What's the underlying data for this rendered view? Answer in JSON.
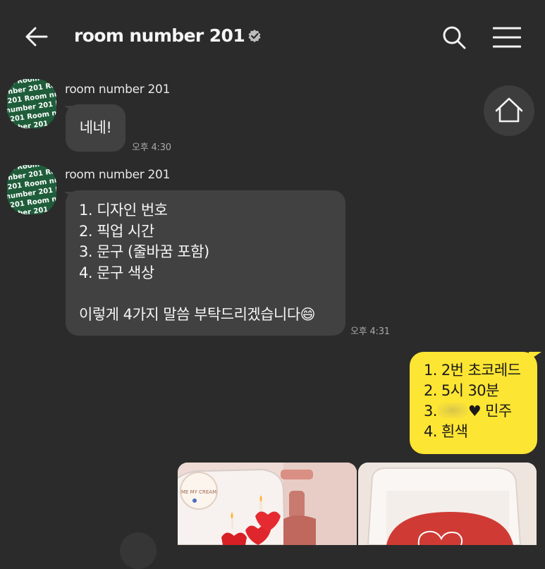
{
  "header": {
    "title": "room number 201",
    "back_icon": "arrow-left-icon",
    "verified_icon": "verified-badge-icon",
    "search_icon": "search-icon",
    "menu_icon": "hamburger-menu-icon"
  },
  "avatar_text": [
    "r 201 Room",
    "number 201 Ro",
    "er 201 Room nu",
    "n number 201 R",
    "er 201 Room nu",
    "number 201"
  ],
  "messages": [
    {
      "sender": "room number 201",
      "lines": [
        "네네!"
      ],
      "time": "오후 4:30"
    },
    {
      "sender": "room number 201",
      "lines": [
        "1. 디자인 번호",
        "2. 픽업 시간",
        "3. 문구 (줄바꿈 포함)",
        "4. 문구 색상",
        "",
        "이렇게 4가지 말씀 부탁드리겠습니다😄"
      ],
      "time": "오후 4:31"
    }
  ],
  "reply": {
    "line1": "1. 2번 초코레드",
    "line2": "2. 5시 30분",
    "line3_prefix": "3.",
    "line3_suffix": "♥ 민주",
    "line4": "4. 흰색"
  },
  "home_icon": "home-icon",
  "photos": {
    "left_label": "ME MY CREAM"
  },
  "colors": {
    "background": "#2b2b2b",
    "incoming_bubble": "#414141",
    "outgoing_bubble": "#fde533"
  }
}
